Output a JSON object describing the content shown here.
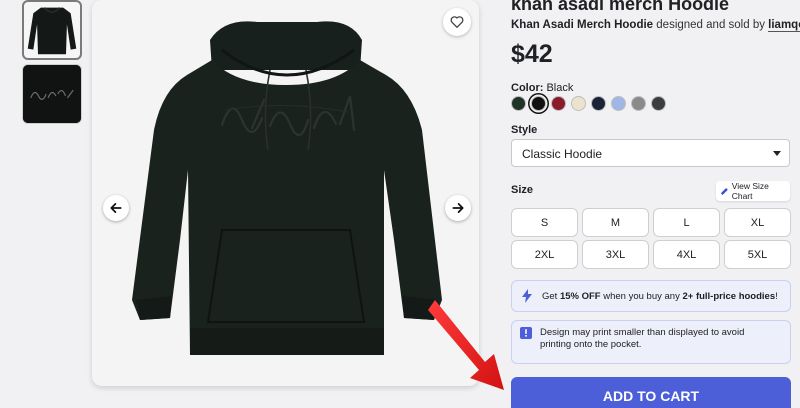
{
  "thumbnails": [
    {
      "icon": "hoodie-thumbnail-icon"
    },
    {
      "icon": "design-thumbnail-icon"
    }
  ],
  "hero": {
    "icons": {
      "favorite": "heart-icon",
      "prev": "arrow-left-icon",
      "next": "arrow-right-icon"
    }
  },
  "product": {
    "title": "khan asadi merch Hoodie",
    "subtitle": "Khan Asadi Merch Hoodie",
    "byline_mid": " designed and sold by ",
    "designer": "liamqopmon",
    "price": "$42"
  },
  "color": {
    "label": "Color:",
    "selected": " Black",
    "swatches": [
      "#1f3329",
      "#111111",
      "#8a1b2b",
      "#ece3cf",
      "#1b2436",
      "#9fb6e6",
      "#8a8a8a",
      "#3b3d40"
    ],
    "selected_index": 1
  },
  "style": {
    "label": "Style",
    "value": "Classic Hoodie"
  },
  "size": {
    "label": "Size",
    "chart_label": "View Size Chart",
    "options": [
      "S",
      "M",
      "L",
      "XL",
      "2XL",
      "3XL",
      "4XL",
      "5XL"
    ]
  },
  "promo": {
    "pre": "Get ",
    "bold1": "15% OFF",
    "mid": " when you buy any ",
    "bold2": "2+ full-price hoodies",
    "post": "!"
  },
  "notice": {
    "text": "Design may print smaller than displayed to avoid printing onto the pocket."
  },
  "cart": {
    "label": "ADD TO CART"
  },
  "colors": {
    "accent": "#4c5fd8",
    "annotation_arrow": "#e81c1c"
  }
}
